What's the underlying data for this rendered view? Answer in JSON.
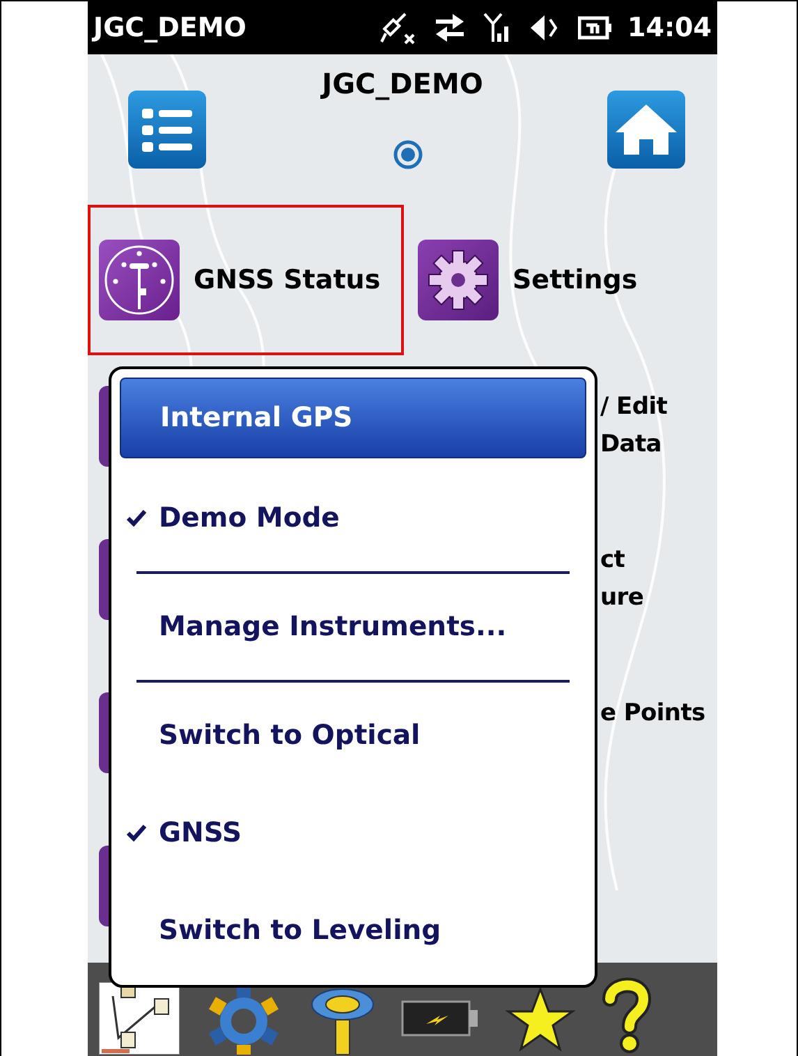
{
  "status_bar": {
    "title": "JGC_DEMO",
    "time": "14:04"
  },
  "header": {
    "title": "JGC_DEMO"
  },
  "home_items": [
    {
      "label": "GNSS Status",
      "kind": "gnss",
      "selected": true
    },
    {
      "label": "Settings",
      "kind": "settings",
      "selected": false
    }
  ],
  "covered_items": [
    {
      "lines": [
        "/ Edit",
        "Data"
      ]
    },
    {
      "lines": [
        "ct",
        "ure"
      ]
    },
    {
      "lines": [
        "e Points"
      ]
    }
  ],
  "menu": {
    "items": [
      {
        "kind": "item",
        "label": "Internal GPS",
        "selected": true,
        "checked": false
      },
      {
        "kind": "item",
        "label": "Demo Mode",
        "selected": false,
        "checked": true
      },
      {
        "kind": "separator"
      },
      {
        "kind": "item",
        "label": "Manage Instruments...",
        "selected": false,
        "checked": false
      },
      {
        "kind": "separator"
      },
      {
        "kind": "item",
        "label": "Switch to Optical",
        "selected": false,
        "checked": false
      },
      {
        "kind": "item",
        "label": "GNSS",
        "selected": false,
        "checked": true
      },
      {
        "kind": "item",
        "label": "Switch to Leveling",
        "selected": false,
        "checked": false
      }
    ]
  }
}
